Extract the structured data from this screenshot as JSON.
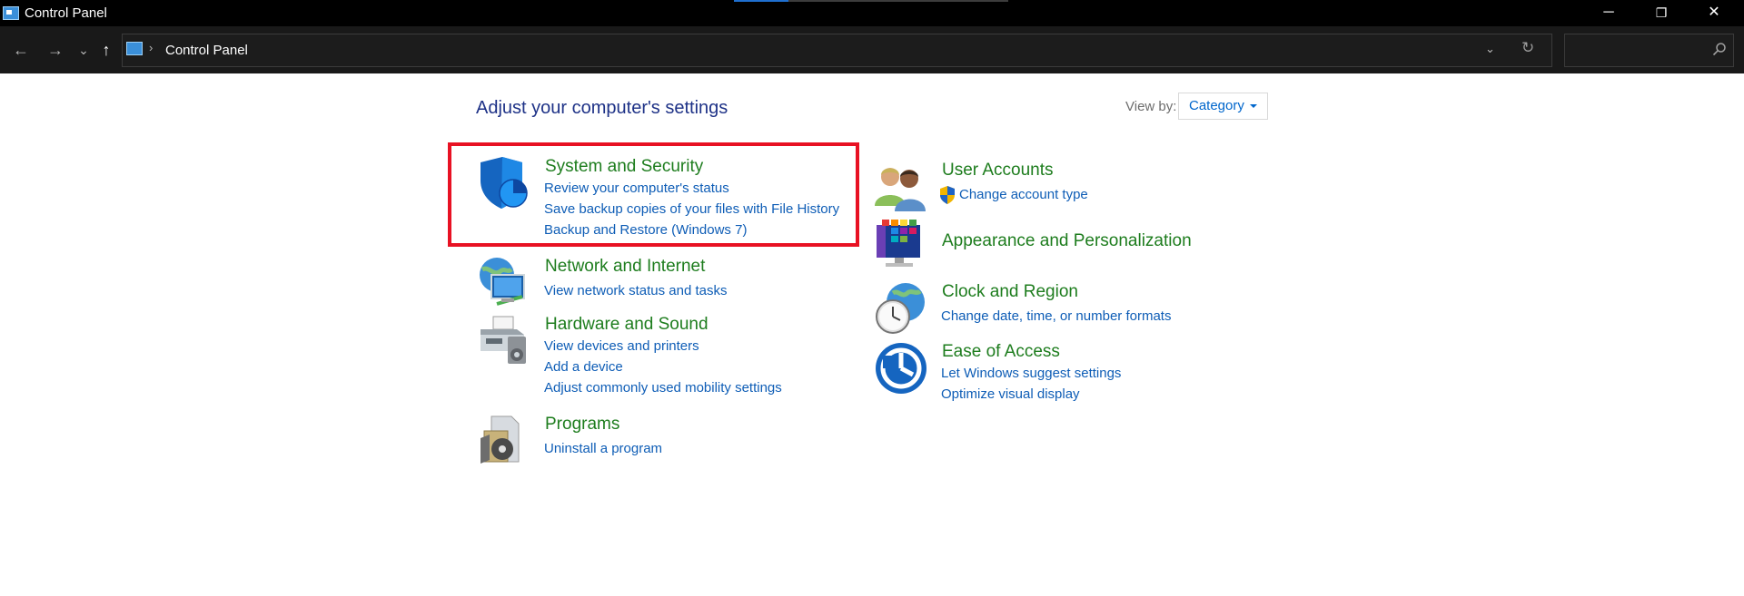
{
  "window": {
    "title": "Control Panel",
    "minimize_glyph": "─",
    "maximize_glyph": "❐",
    "close_glyph": "✕"
  },
  "nav": {
    "back_glyph": "←",
    "forward_glyph": "→",
    "recent_glyph": "⌄",
    "up_glyph": "↑",
    "breadcrumb_separator": "›",
    "breadcrumb": "Control Panel",
    "dropdown_glyph": "⌄",
    "refresh_glyph": "↻",
    "search_placeholder": ""
  },
  "header": {
    "title": "Adjust your computer's settings",
    "view_by_label": "View by:",
    "view_by_value": "Category"
  },
  "categories": {
    "system_security": {
      "title": "System and Security",
      "links": [
        "Review your computer's status",
        "Save backup copies of your files with File History",
        "Backup and Restore (Windows 7)"
      ]
    },
    "network_internet": {
      "title": "Network and Internet",
      "links": [
        "View network status and tasks"
      ]
    },
    "hardware_sound": {
      "title": "Hardware and Sound",
      "links": [
        "View devices and printers",
        "Add a device",
        "Adjust commonly used mobility settings"
      ]
    },
    "programs": {
      "title": "Programs",
      "links": [
        "Uninstall a program"
      ]
    },
    "user_accounts": {
      "title": "User Accounts",
      "links": [
        "Change account type"
      ]
    },
    "appearance": {
      "title": "Appearance and Personalization",
      "links": []
    },
    "clock_region": {
      "title": "Clock and Region",
      "links": [
        "Change date, time, or number formats"
      ]
    },
    "ease_access": {
      "title": "Ease of Access",
      "links": [
        "Let Windows suggest settings",
        "Optimize visual display"
      ]
    }
  },
  "colors": {
    "title_green": "#1e7d1e",
    "link_blue": "#0e5db6",
    "heading_blue": "#1e3287",
    "highlight_red": "#e81123"
  }
}
